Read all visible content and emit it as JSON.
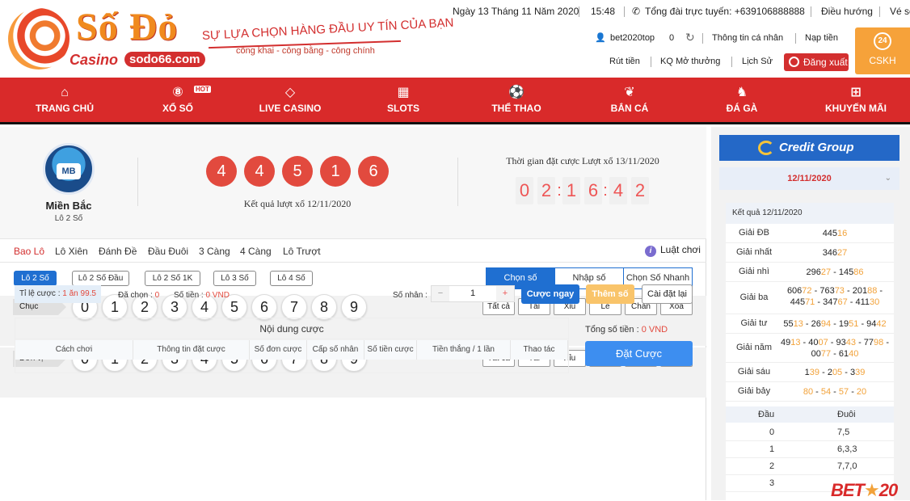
{
  "header": {
    "brand": {
      "title": "Số Đỏ",
      "casino": "Casino",
      "domain": "sodo66.com",
      "slogan": "SỰ LỰA CHỌN HÀNG ĐẦU UY TÍN CỦA BẠN",
      "slogan_sub": "công khai - công bằng - công chính"
    },
    "date": "Ngày 13 Tháng 11 Năm 2020",
    "time": "15:48",
    "hotline": "Tổng đài trực tuyến: +639106888888",
    "guide": "Điều hướng",
    "ticket": "Vé số",
    "username": "bet2020top",
    "balance": "0",
    "profile": "Thông tin cá nhân",
    "deposit": "Nạp tiền",
    "withdraw": "Rút tiền",
    "results": "KQ Mở thưởng",
    "history": "Lịch Sử",
    "logout": "Đăng xuất",
    "cskh": "CSKH",
    "cskh_badge": "24"
  },
  "nav": [
    {
      "label": "TRANG CHỦ",
      "icon": "home-icon",
      "glyph": "⌂"
    },
    {
      "label": "XỔ SỐ",
      "icon": "lottery-ball-icon",
      "glyph": "⑧",
      "badge": "HOT"
    },
    {
      "label": "LIVE CASINO",
      "icon": "diamond-icon",
      "glyph": "◇"
    },
    {
      "label": "SLOTS",
      "icon": "slot-machine-icon",
      "glyph": "▦"
    },
    {
      "label": "THỂ THAO",
      "icon": "soccer-ball-icon",
      "glyph": "⚽"
    },
    {
      "label": "BẮN CÁ",
      "icon": "fish-icon",
      "glyph": "❦"
    },
    {
      "label": "ĐÁ GÀ",
      "icon": "rooster-icon",
      "glyph": "♞"
    },
    {
      "label": "KHUYẾN MÃI",
      "icon": "gift-icon",
      "glyph": "⊞"
    }
  ],
  "lottery": {
    "region": "Miền Bắc",
    "game": "Lô 2 Số",
    "result_numbers": [
      "4",
      "4",
      "5",
      "1",
      "6"
    ],
    "result_label": "Kết quả lượt xổ 12/11/2020",
    "countdown_label": "Thời gian đặt cược Lượt xổ 13/11/2020",
    "countdown_digits": [
      "0",
      "2",
      "1",
      "6",
      "4",
      "2"
    ]
  },
  "tabs": [
    "Bao Lô",
    "Lô Xiên",
    "Đánh Đề",
    "Đầu Đuôi",
    "3 Càng",
    "4 Càng",
    "Lô Trượt"
  ],
  "rules_label": "Luật chơi",
  "subtabs": [
    "Lô 2 Số",
    "Lô 2 Số Đầu",
    "Lô 2 Số 1K",
    "Lô 3 Số",
    "Lô 4 Số"
  ],
  "modes": [
    "Chọn số",
    "Nhập số",
    "Chọn Số Nhanh"
  ],
  "rows": [
    {
      "label": "Chục",
      "numbers": [
        "0",
        "1",
        "2",
        "3",
        "4",
        "5",
        "6",
        "7",
        "8",
        "9"
      ]
    },
    {
      "label": "Đơn vị",
      "numbers": [
        "0",
        "1",
        "2",
        "3",
        "4",
        "5",
        "6",
        "7",
        "8",
        "9"
      ]
    }
  ],
  "quick_buttons": [
    "Tất cả",
    "Tài",
    "Xỉu",
    "Lẻ",
    "Chẵn",
    "Xóa"
  ],
  "bet": {
    "odds_label": "Tỉ lệ cược : ",
    "odds_value": "1 ăn 99.5",
    "selected_label": "Đã chọn : ",
    "selected_value": "0",
    "amount_label": "Số tiền : ",
    "amount_value": "0 VND",
    "multiplier_label": "Số nhân :",
    "multiplier_value": "1",
    "bet_now": "Cược ngay",
    "add_number": "Thêm số",
    "reset": "Cài đặt lại",
    "table_title": "Nội dung cược",
    "columns": [
      "Cách chơi",
      "Thông tin đặt cược",
      "Số đơn cược",
      "Cấp số nhân",
      "Số tiền cược",
      "Tiền thắng / 1 lần",
      "Thao tác"
    ],
    "total_label": "Tổng số tiền : ",
    "total_value": "0 VND",
    "place_bet": "Đặt Cược"
  },
  "sidebar": {
    "brand": "Credit Group",
    "date": "12/11/2020",
    "result_title": "Kết quả 12/11/2020",
    "prizes": [
      {
        "name": "Giải ĐB",
        "values": [
          [
            "445",
            "16"
          ]
        ]
      },
      {
        "name": "Giải nhất",
        "values": [
          [
            "346",
            "27"
          ]
        ]
      },
      {
        "name": "Giải nhì",
        "values": [
          [
            "296",
            "27"
          ],
          [
            "145",
            "86"
          ]
        ]
      },
      {
        "name": "Giải ba",
        "values": [
          [
            "606",
            "72"
          ],
          [
            "763",
            "73"
          ],
          [
            "201",
            "88"
          ],
          [
            "445",
            "71"
          ],
          [
            "347",
            "67"
          ],
          [
            "411",
            "30"
          ]
        ]
      },
      {
        "name": "Giải tư",
        "values": [
          [
            "55",
            "13"
          ],
          [
            "26",
            "94"
          ],
          [
            "19",
            "51"
          ],
          [
            "94",
            "42"
          ]
        ]
      },
      {
        "name": "Giải năm",
        "values": [
          [
            "49",
            "13"
          ],
          [
            "40",
            "07"
          ],
          [
            "93",
            "43"
          ],
          [
            "77",
            "98"
          ],
          [
            "00",
            "77"
          ],
          [
            "61",
            "40"
          ]
        ]
      },
      {
        "name": "Giải sáu",
        "values": [
          [
            "1",
            "39"
          ],
          [
            "2",
            "05"
          ],
          [
            "3",
            "39"
          ]
        ]
      },
      {
        "name": "Giải bảy",
        "values": [
          [
            "",
            "80"
          ],
          [
            "",
            "54"
          ],
          [
            "",
            "57"
          ],
          [
            "",
            "20"
          ]
        ]
      }
    ],
    "head_tail_header": [
      "Đầu",
      "Đuôi"
    ],
    "head_tail": [
      [
        "0",
        "7,5"
      ],
      [
        "1",
        "6,3,3"
      ],
      [
        "2",
        "7,7,0"
      ],
      [
        "3",
        ""
      ]
    ]
  },
  "watermark": "BET20"
}
